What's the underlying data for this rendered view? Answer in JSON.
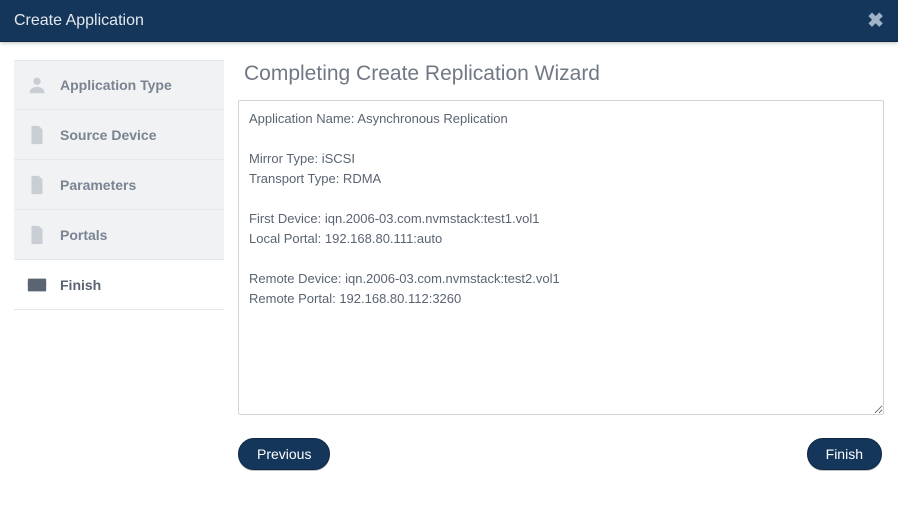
{
  "titlebar": {
    "title": "Create Application"
  },
  "sidebar": {
    "items": [
      {
        "label": "Application Type"
      },
      {
        "label": "Source Device"
      },
      {
        "label": "Parameters"
      },
      {
        "label": "Portals"
      },
      {
        "label": "Finish"
      }
    ]
  },
  "main": {
    "heading": "Completing Create Replication Wizard",
    "summary_text": "Application Name: Asynchronous Replication\n\nMirror Type: iSCSI\nTransport Type: RDMA\n\nFirst Device: iqn.2006-03.com.nvmstack:test1.vol1\nLocal Portal: 192.168.80.111:auto\n\nRemote Device: iqn.2006-03.com.nvmstack:test2.vol1\nRemote Portal: 192.168.80.112:3260"
  },
  "buttons": {
    "previous": "Previous",
    "finish": "Finish"
  }
}
